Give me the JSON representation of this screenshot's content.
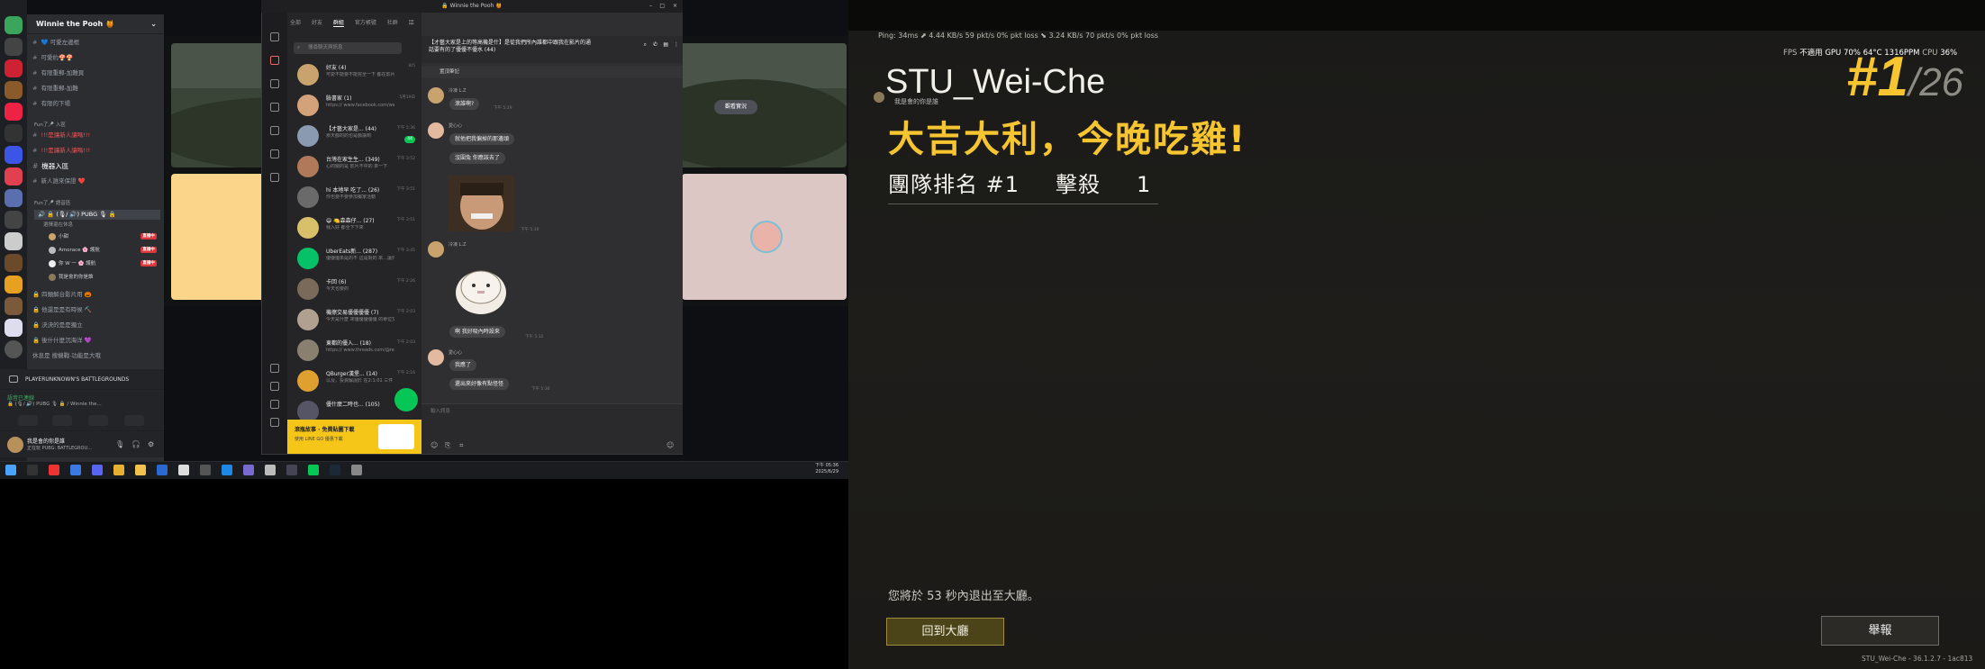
{
  "discord": {
    "server_name": "Winnie the Pooh 🍯",
    "channels": [
      "💙 可愛左邊框",
      "可愛約🍄🍄",
      "有限重郵-加難頁",
      "有限重郵-加難",
      "有限的下場"
    ],
    "category_1": "Fun了🎤 入區",
    "channels_2": [
      "!!!是讓新人讓嗎!!!",
      "!!!是讓新人讓嗎!!!",
      "機器入區",
      "新人誰來保證 ❤️"
    ],
    "category_2": "Fun了🎤 語音區",
    "voice_channel": "🔒 (🎙/ 🔊) PUBG 🎙 🔒",
    "voice_channel_sub": "選擇還在休息",
    "voice_users": [
      {
        "name": "小甜",
        "live": "直播中"
      },
      {
        "name": "Amorace 🌸 護航",
        "live": "直播中"
      },
      {
        "name": "你 W 一 🌸 護航",
        "live": "直播中"
      },
      {
        "name": "我是會的你是誰",
        "live": ""
      }
    ],
    "voice_channels_more": [
      "🔒 四類解台影片用 🎃",
      "🔒 他還是是有時候 ⛏️",
      "🔒 決決的是是獨立",
      "🔒 後什什麼沉海洋 💜",
      "休息是 搜機戰-功能是大哦"
    ],
    "activity": "PLAYERUNKNOWN'S BATTLEGROUNDS",
    "voice_connected": "語音已連線",
    "voice_connected_sub": "🔒 (🎙/ 🔊) PUBG 🎙 🔒 / Winnie the...",
    "user_name": "我是會的你是誰",
    "user_status": "正在玩 PUBG: BATTLEGROU...",
    "watch_stream": "觀看實況"
  },
  "line": {
    "window_title": "🔒 Winnie the Pooh 🍯",
    "tabs": [
      "全部",
      "好友",
      "群組",
      "官方帳號",
      "社群",
      "㗊"
    ],
    "active_tab": "群組",
    "search_placeholder": "搜尋聊天與訊息",
    "chats": [
      {
        "name": "好友 (4)",
        "preview": "可愛不能要不能完全一下 都在影片中",
        "time": "8/5"
      },
      {
        "name": "臉書家 (1)",
        "preview": "https:// www.facebook.com/wa...",
        "time": "5月19日"
      },
      {
        "name": "【才藝大家是... (44)",
        "preview": "那天都的的也是都講到",
        "time": "下午 5:36",
        "badge": "44"
      },
      {
        "name": "台灣在家生生... (349)",
        "preview": "心的關的是 影片不中的 來一下",
        "time": "下午 3:52"
      },
      {
        "name": "hi 本地早 吃了... (26)",
        "preview": "你也要不要參加獨家活動",
        "time": "下午 3:51"
      },
      {
        "name": "😄 🍋森森仔... (27)",
        "preview": "我入好 都全下下來",
        "time": "下午 3:51"
      },
      {
        "name": "UberEats新... (287)",
        "preview": "優優優來是的不 這是對的 來...讓你開也更一直...",
        "time": "下午 3:45"
      },
      {
        "name": "卡回 (6)",
        "preview": "今天也要的",
        "time": "下午 2:26"
      },
      {
        "name": "機擦交易優優優優 (7)",
        "preview": "今天是什麼 來優優優優優 的單位交的但是優優",
        "time": "下午 2:03"
      },
      {
        "name": "東都的優入... (18)",
        "preview": "https:// www.threads.com/@re...",
        "time": "下午 2:03"
      },
      {
        "name": "QBurger漢堡... (14)",
        "preview": "以及，投資解說於 在2:1:01 三件 ☕ 🍰 新的",
        "time": "下午 2:16"
      },
      {
        "name": "優什麼二時也... (105)",
        "preview": "",
        "time": "下午 1:47"
      }
    ],
    "banner_text": "滾瓶故事 · 免費貼圖下載",
    "banner_sub": "使用 LINE GO 優惠下載",
    "chat_title": "【才藝大家是上的等高機是什】是從我們所內誰都中跟我在影片的通話要有的了優優不優水 (44)",
    "pinned": "置頂筆記",
    "messages": [
      {
        "name": "冷凍 L.Z",
        "text": "滾誰啊?",
        "time": "下午 5:29"
      },
      {
        "name": "愛心心",
        "text": "就他把我偏掉的那邊頭",
        "time": ""
      },
      {
        "name": "",
        "text": "沒圍兔 你應該去了",
        "time": ""
      },
      {
        "name": "",
        "text": "",
        "time": "下午 5:30"
      },
      {
        "name": "冷凍 L.Z",
        "text": "",
        "time": ""
      },
      {
        "name": "",
        "text": "啊 我好吸內時設來",
        "time": "下午 5:32"
      },
      {
        "name": "愛心心",
        "text": "我應了",
        "time": ""
      },
      {
        "name": "",
        "text": "還出來好像有點怪怪",
        "time": "下午 5:36"
      }
    ],
    "input_placeholder": "輸入訊息"
  },
  "taskbar": {
    "time": "下午 05:36",
    "date": "2025/6/29"
  },
  "pubg": {
    "net_stats": "Ping: 34ms   ⬈ 4.44 KB/s   59 pkt/s   0% pkt loss   ⬊ 3.24 KB/s   70 pkt/s   0% pkt loss",
    "fps_label": "FPS",
    "gpu_label": "不適用 GPU",
    "gpu_value": "70% 64°C 1316PPM",
    "cpu_label": "CPU",
    "cpu_value": "36%",
    "player_name": "STU_Wei-Che",
    "small_line": "我是會的你是誰",
    "headline": "大吉大利，今晚吃雞!",
    "rank_label": "團隊排名 #1",
    "kills_label": "擊殺",
    "kills_value": "1",
    "big_rank": "#1",
    "big_total": "/26",
    "leave_text": "您將於 53 秒內退出至大廳。",
    "lobby_button": "回到大廳",
    "report_button": "舉報",
    "version": "STU_Wei-Che - 36.1.2.7 - 1ac813",
    "accent": "#f7c530"
  }
}
